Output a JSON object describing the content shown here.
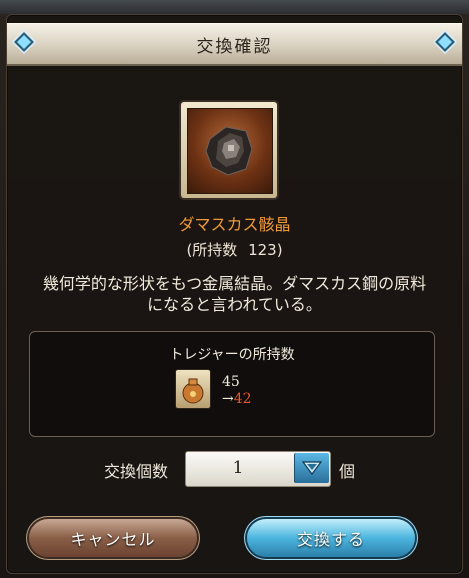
{
  "dialog": {
    "title": "交換確認",
    "item": {
      "name": "ダマスカス骸晶",
      "owned_label": "(所持数",
      "owned_count": "123)",
      "description": "幾何学的な形状をもつ金属結晶。ダマスカス鋼の原料になると言われている。"
    },
    "treasure": {
      "title": "トレジャーの所持数",
      "current": "45",
      "arrow": "→",
      "after": "42"
    },
    "quantity": {
      "label": "交換個数",
      "value": "1",
      "unit": "個"
    },
    "buttons": {
      "cancel": "キャンセル",
      "exchange": "交換する"
    }
  },
  "colors": {
    "item_name": "#f29a37",
    "after_count": "#e8572d",
    "exchange_button": "#4cb5de",
    "cancel_button": "#8a5f48"
  },
  "icons": {
    "corner": "diamond-gem-icon",
    "item": "damascus-crystal-icon",
    "treasure": "treasure-bag-icon",
    "dropdown": "chevron-down-icon"
  }
}
